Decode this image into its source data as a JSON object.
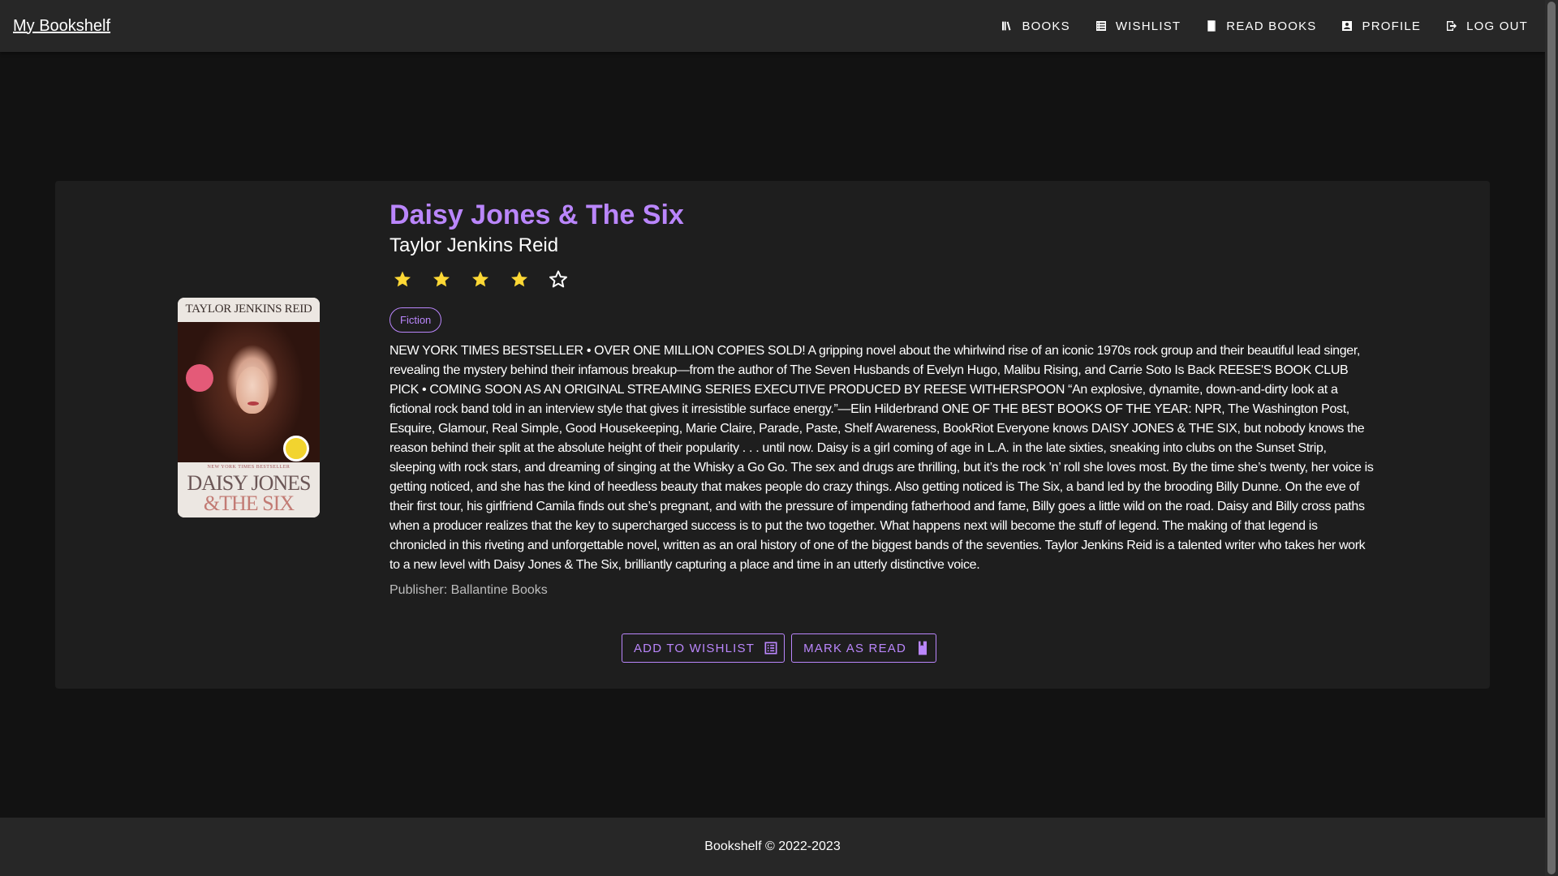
{
  "app": {
    "brand": "My Bookshelf"
  },
  "nav": {
    "items": [
      {
        "label": "Books",
        "icon": "library-icon"
      },
      {
        "label": "Wishlist",
        "icon": "list-icon"
      },
      {
        "label": "Read Books",
        "icon": "bookmark-icon"
      },
      {
        "label": "Profile",
        "icon": "account-box-icon"
      },
      {
        "label": "Log Out",
        "icon": "logout-icon"
      }
    ]
  },
  "book": {
    "title": "Daisy Jones & The Six",
    "author": "Taylor Jenkins Reid",
    "rating": 4,
    "rating_max": 5,
    "genre": "Fiction",
    "description": "NEW YORK TIMES BESTSELLER • OVER ONE MILLION COPIES SOLD! A gripping novel about the whirlwind rise of an iconic 1970s rock group and their beautiful lead singer, revealing the mystery behind their infamous breakup—from the author of The Seven Husbands of Evelyn Hugo, Malibu Rising, and Carrie Soto Is Back REESE'S BOOK CLUB PICK • COMING SOON AS AN ORIGINAL STREAMING SERIES EXECUTIVE PRODUCED BY REESE WITHERSPOON “An explosive, dynamite, down-and-dirty look at a fictional rock band told in an interview style that gives it irresistible surface energy.”—Elin Hilderbrand ONE OF THE BEST BOOKS OF THE YEAR: NPR, The Washington Post, Esquire, Glamour, Real Simple, Good Housekeeping, Marie Claire, Parade, Paste, Shelf Awareness, BookRiot Everyone knows DAISY JONES & THE SIX, but nobody knows the reason behind their split at the absolute height of their popularity . . . until now. Daisy is a girl coming of age in L.A. in the late sixties, sneaking into clubs on the Sunset Strip, sleeping with rock stars, and dreaming of singing at the Whisky a Go Go. The sex and drugs are thrilling, but it’s the rock ’n’ roll she loves most. By the time she’s twenty, her voice is getting noticed, and she has the kind of heedless beauty that makes people do crazy things. Also getting noticed is The Six, a band led by the brooding Billy Dunne. On the eve of their first tour, his girlfriend Camila finds out she’s pregnant, and with the pressure of impending fatherhood and fame, Billy goes a little wild on the road. Daisy and Billy cross paths when a producer realizes that the key to supercharged success is to put the two together. What happens next will become the stuff of legend. The making of that legend is chronicled in this riveting and unforgettable novel, written as an oral history of one of the biggest bands of the seventies. Taylor Jenkins Reid is a talented writer who takes her work to a new level with Daisy Jones & The Six, brilliantly capturing a place and time in an utterly distinctive voice.",
    "publisher": "Publisher: Ballantine Books",
    "cover": {
      "top_text": "TAYLOR JENKINS REID",
      "small_text": "NEW YORK TIMES BESTSELLER",
      "title_line1": "DAISY JONES",
      "title_line2": "&THE SIX"
    }
  },
  "actions": {
    "wishlist_label": "Add to Wishlist",
    "read_label": "Mark as Read"
  },
  "footer": {
    "text": "Bookshelf © 2022-2023"
  },
  "colors": {
    "accent": "#ba86fc",
    "star": "#fdd835",
    "background": "#121212",
    "surface": "#1e1e1e",
    "appbar": "#272727"
  }
}
